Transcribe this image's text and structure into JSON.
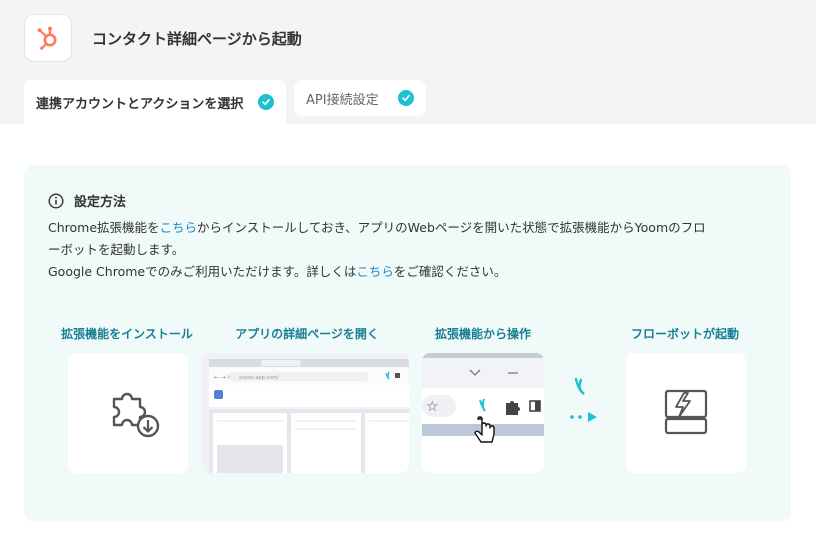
{
  "header": {
    "app_icon": "hubspot-logo",
    "title": "コンタクト詳細ページから起動"
  },
  "tabs": [
    {
      "label": "連携アカウントとアクションを選択",
      "done": true,
      "icon": "check-circle-icon"
    },
    {
      "label": "API接続設定",
      "done": true,
      "icon": "check-circle-icon"
    }
  ],
  "setup": {
    "heading": "設定方法",
    "heading_icon": "info-icon",
    "line1_pre": "Chrome拡張機能を",
    "line1_link": "こちら",
    "line1_post": "からインストールしておき、アプリのWebページを開いた状態で拡張機能からYoomのフロ",
    "line2": "ーボットを起動します。",
    "line3_pre": "Google Chromeでのみご利用いただけます。詳しくは",
    "line3_link": "こちら",
    "line3_post": "をご確認ください。"
  },
  "steps": [
    {
      "label": "拡張機能をインストール",
      "icon": "puzzle-download-icon"
    },
    {
      "label": "アプリの詳細ページを開く",
      "icon": "browser-screenshot"
    },
    {
      "label": "拡張機能から操作",
      "icon": "extension-toolbar"
    },
    {
      "label": "フローボットが起動",
      "icon": "flowbot-icon"
    }
  ],
  "browser_mock": {
    "url": "xxxxx.app.com/"
  },
  "colors": {
    "accent": "#1fc0d2",
    "link": "#1e88c8",
    "label": "#1a7f95",
    "card_bg": "#effaf9"
  }
}
